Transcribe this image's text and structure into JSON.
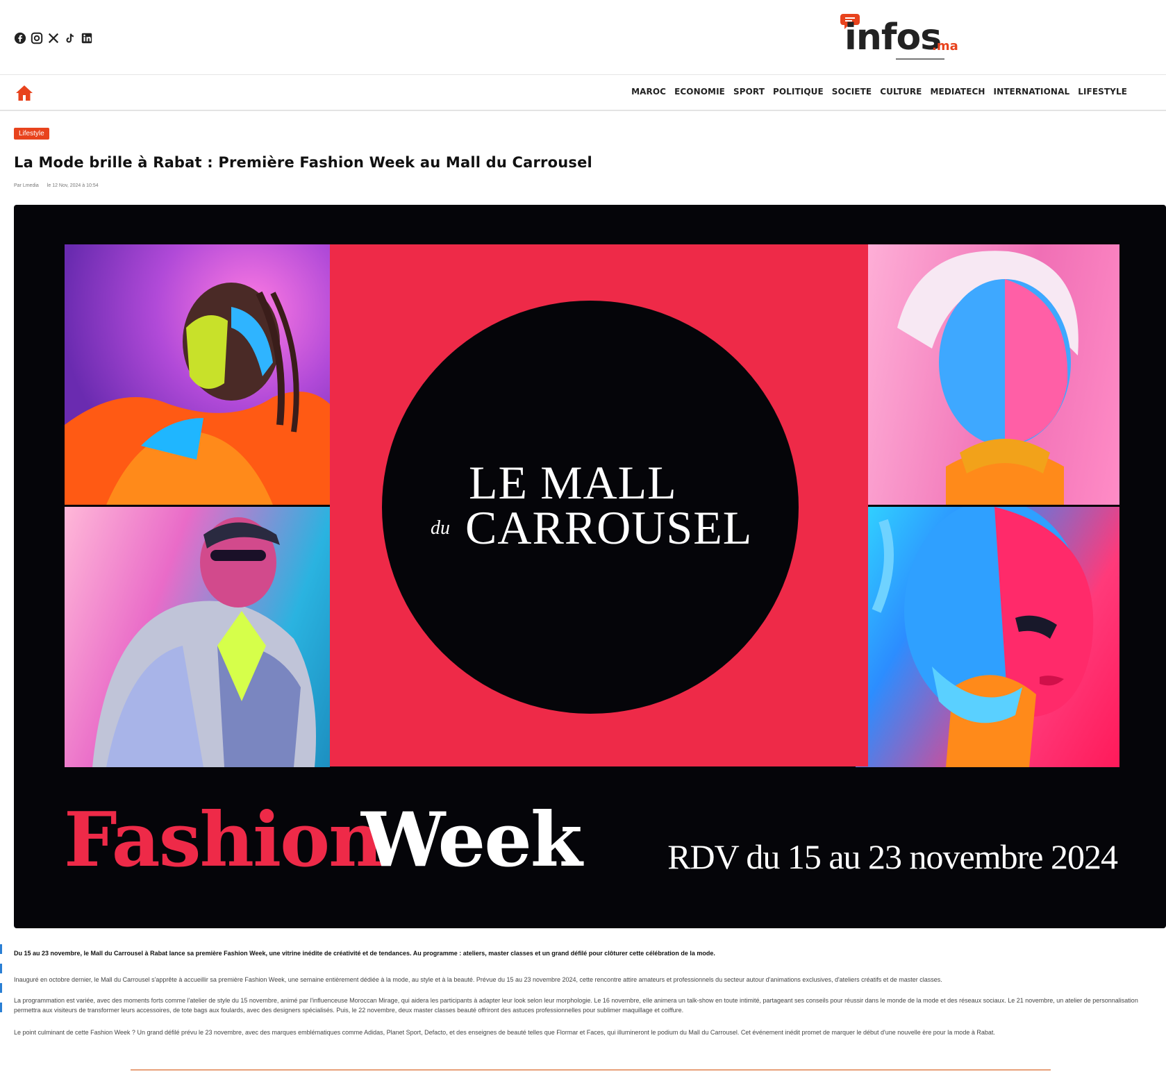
{
  "brand": {
    "name": "infos",
    "tld": ".ma",
    "accent": "#e8431d"
  },
  "socials": [
    {
      "icon": "facebook-icon"
    },
    {
      "icon": "instagram-icon"
    },
    {
      "icon": "x-icon"
    },
    {
      "icon": "tiktok-icon"
    },
    {
      "icon": "linkedin-icon"
    }
  ],
  "nav": {
    "home_icon": "home-icon",
    "items": [
      "MAROC",
      "ECONOMIE",
      "SPORT",
      "POLITIQUE",
      "SOCIETE",
      "CULTURE",
      "MEDIATECH",
      "INTERNATIONAL",
      "LIFESTYLE"
    ]
  },
  "article": {
    "category": "Lifestyle",
    "title": "La Mode brille à Rabat : Première Fashion Week au Mall du Carrousel",
    "meta": {
      "author": "Par Lmedia",
      "date": "le 12 Nov, 2024 à 10:54"
    },
    "hero": {
      "brand_line1": "LE MALL",
      "brand_du": "du",
      "brand_line2": "CARROUSEL",
      "fashion": "Fashion",
      "week": "Week",
      "date_line": "RDV du 15 au 23 novembre 2024",
      "red": "#ee2a48"
    },
    "lead": "Du 15 au 23 novembre, le Mall du Carrousel à Rabat lance sa première Fashion Week, une vitrine inédite de créativité et de tendances. Au programme : ateliers, master classes et un grand défilé pour clôturer cette célébration de la mode.",
    "paragraphs": [
      "Inauguré en octobre dernier, le Mall du Carrousel s'apprête à accueillir sa première Fashion Week, une semaine entièrement dédiée à la mode, au style et à la beauté. Prévue du 15 au 23 novembre 2024, cette rencontre attire amateurs et professionnels du secteur autour d'animations exclusives, d'ateliers créatifs et de master classes.",
      "La programmation est variée, avec des moments forts comme l'atelier de style du 15 novembre, animé par l'influenceuse Moroccan Mirage, qui aidera les participants à adapter leur look selon leur morphologie. Le 16 novembre, elle animera un talk-show en toute intimité, partageant ses conseils pour réussir dans le monde de la mode et des réseaux sociaux. Le 21 novembre, un atelier de personnalisation permettra aux visiteurs de transformer leurs accessoires, de tote bags aux foulards, avec des designers spécialisés. Puis, le 22 novembre, deux master classes beauté offriront des astuces professionnelles pour sublimer maquillage et coiffure.",
      "Le point culminant de cette Fashion Week ? Un grand défilé prévu le 23 novembre, avec des marques emblématiques comme Adidas, Planet Sport, Defacto, et des enseignes de beauté telles que Flormar et Faces, qui illumineront le podium du Mall du Carrousel. Cet événement inédit promet de marquer le début d'une nouvelle ère pour la mode à Rabat."
    ]
  }
}
